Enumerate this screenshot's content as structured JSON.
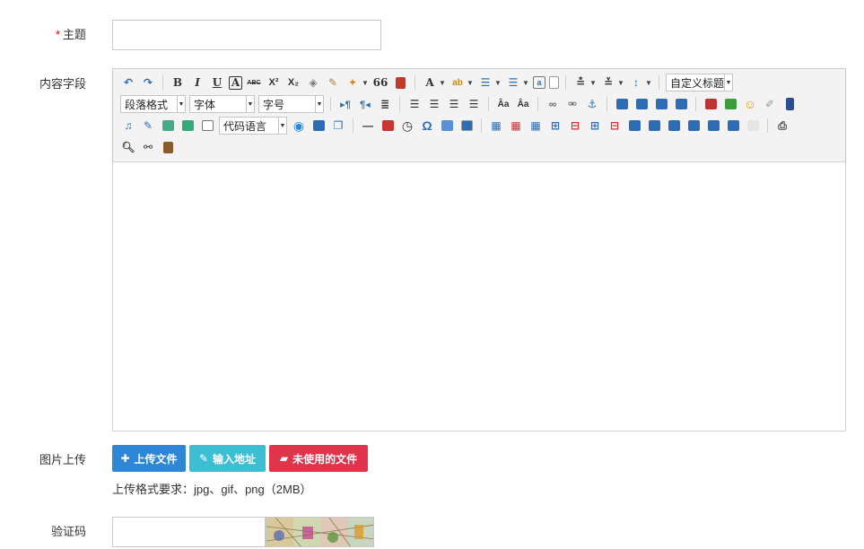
{
  "form": {
    "subject": {
      "required_mark": "*",
      "label": "主题",
      "value": ""
    },
    "content": {
      "label": "内容字段"
    },
    "image_upload": {
      "label": "图片上传",
      "upload_button": "上传文件",
      "url_button": "输入地址",
      "unused_button": "未使用的文件",
      "hint": "上传格式要求：jpg、gif、png（2MB）"
    },
    "captcha": {
      "label": "验证码",
      "value": ""
    }
  },
  "editor": {
    "toolbar": {
      "custom_heading": "自定义标题",
      "paragraph_format": "段落格式",
      "font_family": "字体",
      "font_size": "字号",
      "code_language": "代码语言",
      "bold": "B",
      "italic": "I",
      "underline": "U",
      "font_border": "A",
      "strikethrough": "ABC",
      "superscript": "X²",
      "subscript": "X₂",
      "blockquote": "66",
      "font_color": "A",
      "special_char": "Ω"
    },
    "colors": {
      "accent_blue": "#2d87d6",
      "accent_cyan": "#3cbfd2",
      "accent_red": "#e0344b"
    }
  }
}
